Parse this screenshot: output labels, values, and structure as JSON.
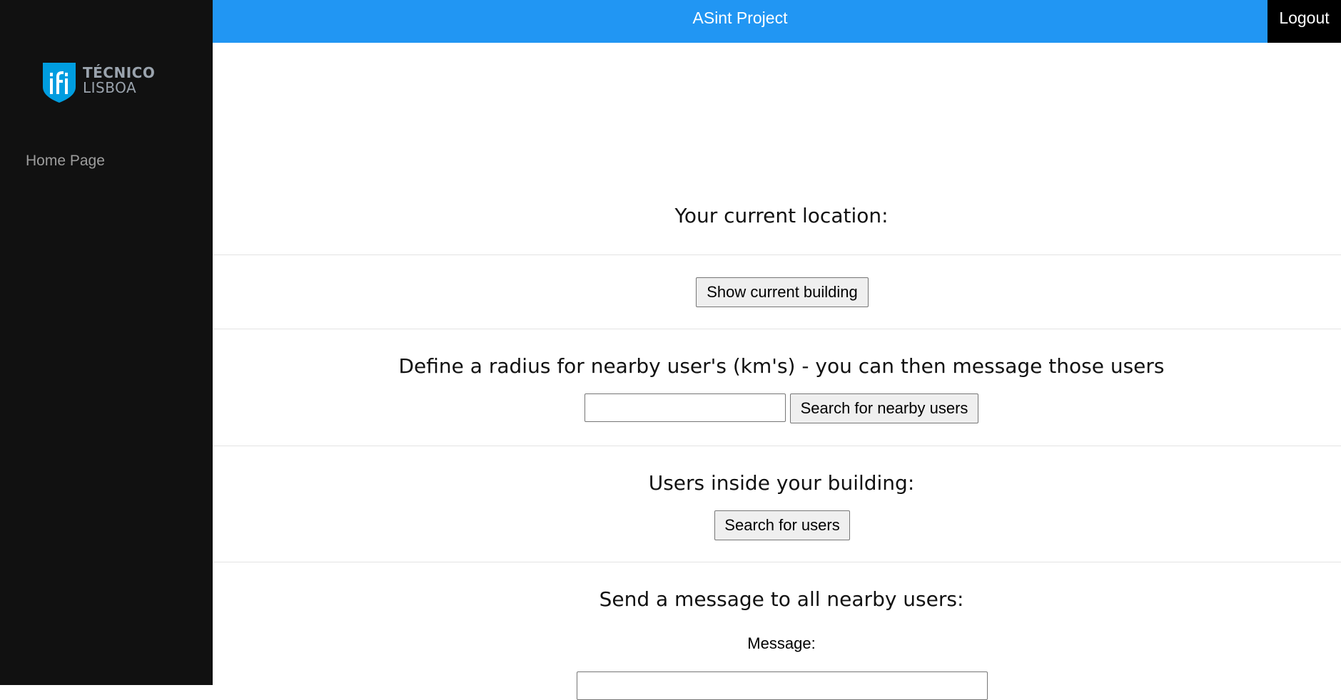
{
  "app": {
    "title": "ASint Project",
    "logout_label": "Logout"
  },
  "logo": {
    "line1": "TÉCNICO",
    "line2": "LISBOA",
    "brand_color": "#009de0"
  },
  "sidebar": {
    "items": [
      {
        "label": "Home Page"
      }
    ]
  },
  "main": {
    "location": {
      "heading": "Your current location:",
      "button_label": "Show current building"
    },
    "nearby": {
      "heading": "Define a radius for nearby user's (km's) - you can then message those users",
      "radius_value": "",
      "radius_placeholder": "",
      "button_label": "Search for nearby users"
    },
    "building_users": {
      "heading": "Users inside your building:",
      "button_label": "Search for users"
    },
    "message": {
      "heading": "Send a message to all nearby users:",
      "field_label": "Message:",
      "value": ""
    }
  },
  "colors": {
    "topbar": "#2196f3",
    "sidebar": "#111111",
    "logout_bg": "#000000"
  }
}
